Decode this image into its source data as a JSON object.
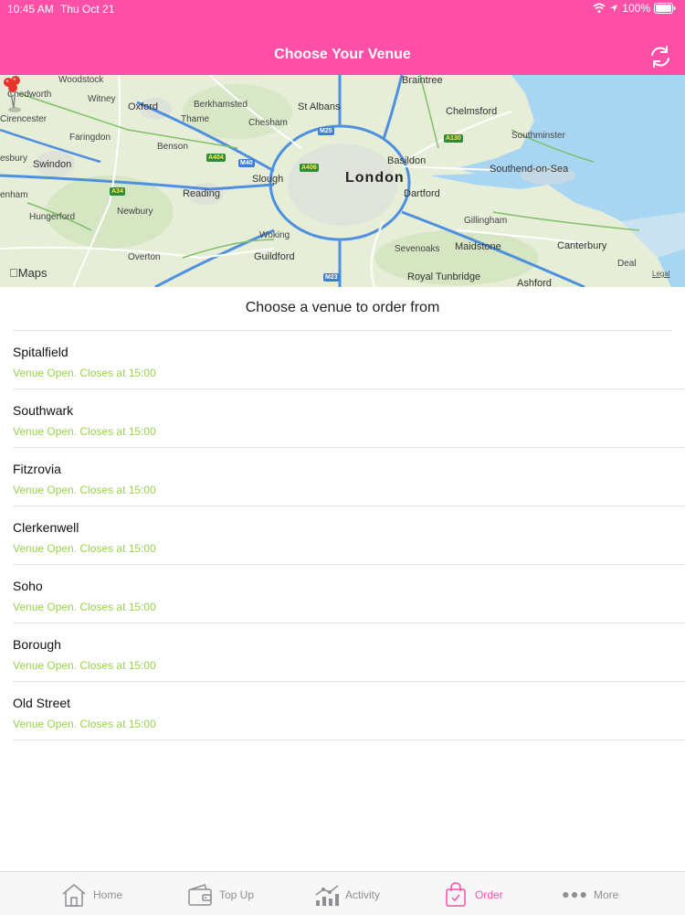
{
  "status_bar": {
    "time": "10:45 AM",
    "date": "Thu Oct 21",
    "battery": "100%"
  },
  "header": {
    "title": "Choose Your Venue",
    "refresh_icon": "refresh-icon"
  },
  "map": {
    "brand": "Maps",
    "legal": "Legal",
    "labels": {
      "woodstock": "Woodstock",
      "chedworth": "Chedworth",
      "witney": "Witney",
      "oxford": "Oxford",
      "berkhamsted": "Berkhamsted",
      "thame": "Thame",
      "chesham": "Chesham",
      "st_albans": "St Albans",
      "braintree": "Braintree",
      "chelmsford": "Chelmsford",
      "cirencester": "Cirencester",
      "faringdon": "Faringdon",
      "southminster": "Southminster",
      "esbury": "esbury",
      "swindon": "Swindon",
      "benson": "Benson",
      "basildon": "Basildon",
      "southend": "Southend-on-Sea",
      "slough": "Slough",
      "london": "London",
      "enham": "enham",
      "reading": "Reading",
      "dartford": "Dartford",
      "hungerford": "Hungerford",
      "newbury": "Newbury",
      "gillingham": "Gillingham",
      "woking": "Woking",
      "sevenoaks": "Sevenoaks",
      "maidstone": "Maidstone",
      "canterbury": "Canterbury",
      "overton": "Overton",
      "guildford": "Guildford",
      "deal": "Deal",
      "royal_tunbridge": "Royal Tunbridge",
      "ashford": "Ashford"
    },
    "shields": {
      "m25": "M25",
      "a130": "A130",
      "a404": "A404",
      "m40": "M40",
      "a406": "A406",
      "a34": "A34",
      "m23": "M23"
    },
    "colors": {
      "water": "#a8d6f2",
      "land": "#e6eed8",
      "motorway": "#4f8fe0",
      "road": "#ffffff",
      "pin": "#e8342c"
    }
  },
  "list_title": "Choose a venue to order from",
  "venues": [
    {
      "name": "Spitalfield",
      "status": "Venue Open. Closes at 15:00"
    },
    {
      "name": "Southwark",
      "status": "Venue Open. Closes at 15:00"
    },
    {
      "name": "Fitzrovia",
      "status": "Venue Open. Closes at 15:00"
    },
    {
      "name": "Clerkenwell",
      "status": "Venue Open. Closes at 15:00"
    },
    {
      "name": "Soho",
      "status": "Venue Open. Closes at 15:00"
    },
    {
      "name": "Borough",
      "status": "Venue Open. Closes at 15:00"
    },
    {
      "name": "Old Street",
      "status": "Venue Open. Closes at 15:00"
    }
  ],
  "tabs": [
    {
      "label": "Home",
      "icon": "home-icon"
    },
    {
      "label": "Top Up",
      "icon": "wallet-icon"
    },
    {
      "label": "Activity",
      "icon": "activity-icon"
    },
    {
      "label": "Order",
      "icon": "shopping-bag-icon",
      "active": true
    },
    {
      "label": "More",
      "icon": "more-icon"
    }
  ],
  "colors": {
    "brand": "#ff4fa7",
    "open_status": "#9bd34d",
    "tab_inactive": "#8e8e93"
  }
}
